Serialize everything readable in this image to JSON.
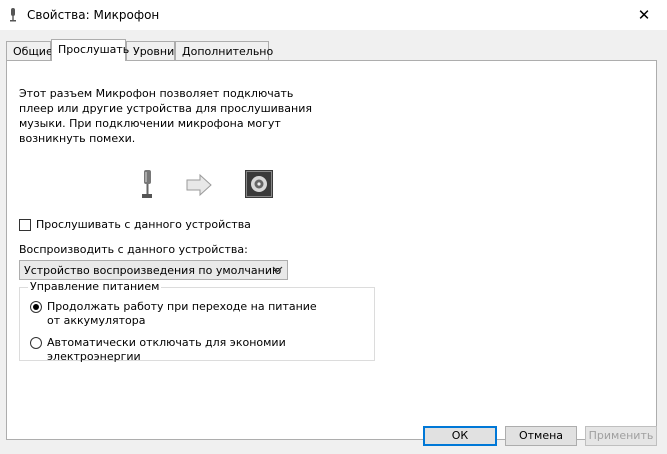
{
  "window": {
    "title": "Свойства: Микрофон",
    "close_glyph": "✕"
  },
  "tabs": [
    {
      "label": "Общие",
      "active": false
    },
    {
      "label": "Прослушать",
      "active": true
    },
    {
      "label": "Уровни",
      "active": false
    },
    {
      "label": "Дополнительно",
      "active": false
    }
  ],
  "listen": {
    "description": "Этот разъем Микрофон позволяет подключать плеер или другие устройства для прослушивания музыки. При подключении микрофона могут возникнуть помехи.",
    "listen_checkbox_label": "Прослушивать с данного устройства",
    "listen_checked": false,
    "playback_label": "Воспроизводить с данного устройства:",
    "playback_selected": "Устройство воспроизведения по умолчанию",
    "power": {
      "title": "Управление питанием",
      "continue_label": "Продолжать работу при переходе на питание от аккумулятора",
      "auto_off_label": "Автоматически отключать для экономии электроэнергии",
      "selected": "continue"
    }
  },
  "buttons": {
    "ok": "ОК",
    "cancel": "Отмена",
    "apply": "Применить"
  },
  "colors": {
    "accent": "#0078d7",
    "panel_bg": "#ffffff",
    "client_bg": "#f0f0f0"
  }
}
